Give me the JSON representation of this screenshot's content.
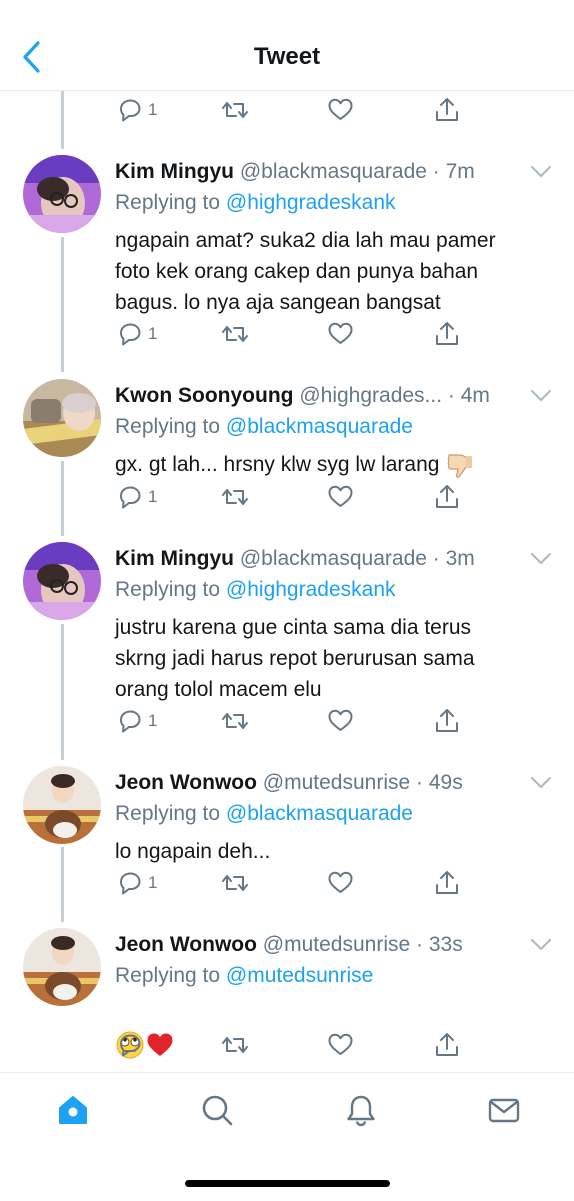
{
  "header": {
    "title": "Tweet",
    "back_icon": "back-chevron-icon"
  },
  "top_actions": {
    "reply_count": "1"
  },
  "tweets": [
    {
      "name": "Kim Mingyu",
      "handle": "@blackmasquarade",
      "time": "7m",
      "replying_prefix": "Replying to ",
      "replying_to": "@highgradeskank",
      "text": "ngapain amat? suka2 dia lah mau pamer\nfoto kek orang cakep dan punya bahan\nbagus. lo nya aja sangean bangsat",
      "reply_count": "1"
    },
    {
      "name": "Kwon Soonyoung",
      "handle": "@highgrades...",
      "time": "4m",
      "replying_prefix": "Replying to ",
      "replying_to": "@blackmasquarade",
      "text": "gx. gt lah... hrsny klw syg lw larang",
      "emoji": "thumbs-down",
      "reply_count": "1"
    },
    {
      "name": "Kim Mingyu",
      "handle": "@blackmasquarade",
      "time": "3m",
      "replying_prefix": "Replying to ",
      "replying_to": "@highgradeskank",
      "text": "justru karena gue cinta sama dia terus\nskrng jadi harus repot berurusan sama\norang tolol macem elu",
      "reply_count": "1"
    },
    {
      "name": "Jeon Wonwoo",
      "handle": "@mutedsunrise",
      "time": "49s",
      "replying_prefix": "Replying to ",
      "replying_to": "@blackmasquarade",
      "text": "lo ngapain deh...",
      "reply_count": "1"
    },
    {
      "name": "Jeon Wonwoo",
      "handle": "@mutedsunrise",
      "time": "33s",
      "replying_prefix": "Replying to ",
      "replying_to": "@mutedsunrise",
      "text": "",
      "emoji": "eye-roll, red-heart",
      "reply_count": ""
    }
  ],
  "colors": {
    "accent": "#1da1f2",
    "secondary": "#657786",
    "text": "#14171a",
    "thread_line": "#c4cfd6"
  },
  "tabbar": [
    "home-icon",
    "search-icon",
    "notifications-icon",
    "messages-icon"
  ]
}
